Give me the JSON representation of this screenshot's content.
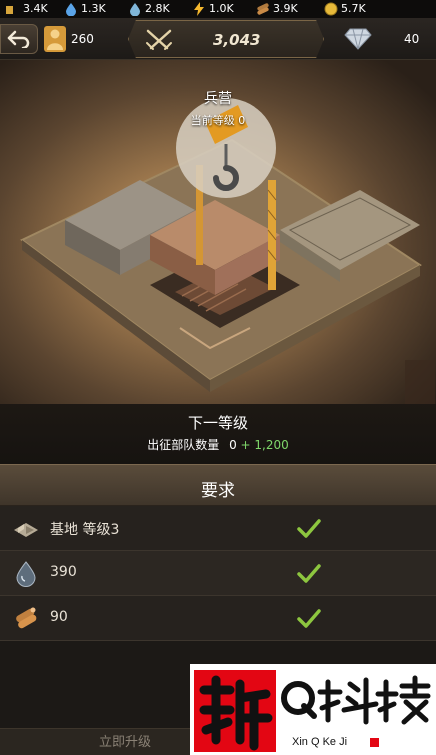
{
  "resources": [
    {
      "icon": "gold-bar-icon",
      "value": "3.4K"
    },
    {
      "icon": "water-drop-icon",
      "value": "1.3K"
    },
    {
      "icon": "oil-drop-icon",
      "value": "2.8K"
    },
    {
      "icon": "lightning-icon",
      "value": "1.0K"
    },
    {
      "icon": "wood-logs-icon",
      "value": "3.9K"
    },
    {
      "icon": "coin-icon",
      "value": "5.7K"
    }
  ],
  "header": {
    "troops": "260",
    "power": "3,043",
    "gems": "40"
  },
  "building": {
    "name": "兵营",
    "current_level": "当前等级 0"
  },
  "next_level": {
    "title": "下一等级",
    "stat_label": "出征部队数量",
    "stat_base": "0",
    "stat_bonus": "+ 1,200"
  },
  "requirements": {
    "title": "要求",
    "items": [
      {
        "icon": "base-building-icon",
        "label": "基地 等级3",
        "met": true
      },
      {
        "icon": "water-drop-icon",
        "label": "390",
        "met": true
      },
      {
        "icon": "wood-logs-icon",
        "label": "90",
        "met": true
      }
    ]
  },
  "actions": {
    "upgrade_now": "立即升级"
  },
  "watermark": {
    "logo_char": "新",
    "brand": "Q科技",
    "pinyin": "Xin Q Ke Ji"
  },
  "colors": {
    "check": "#8dc63f",
    "bonus": "#7fd86a",
    "watermark_red": "#e30613"
  }
}
